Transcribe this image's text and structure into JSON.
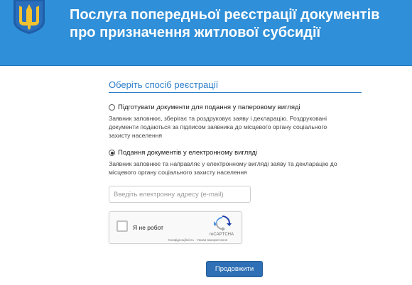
{
  "header": {
    "title_line1": "Послуга попередньої реєстрації документів",
    "title_line2": "про призначення житлової субсидії",
    "emblem_icon": "trident-emblem-icon",
    "background_color": "#2f8fd8"
  },
  "registration": {
    "section_title": "Оберіть спосіб реєстрації",
    "options": [
      {
        "label": "Підготувати документи для подання у паперовому вигляді",
        "description_line1": "Заявник заповнює, зберігає та роздруковує заяву і декларацію. Роздруковані",
        "description_line2": "документи подаються за підписом заявника до місцевого органу соціального",
        "description_line3": "захисту населення",
        "selected": false
      },
      {
        "label": "Подання документів у електронному вигляді",
        "description_line1": "Заявник заповнює та направляє у електронному вигляді заяву та декларацію до",
        "description_line2": "місцевого органу соціального захисту населення",
        "selected": true
      }
    ],
    "email": {
      "placeholder": "Введіть електронну адресу (e-mail)",
      "value": ""
    },
    "captcha": {
      "label": "Я не робот",
      "brand": "reCAPTCHA",
      "terms": "Конфіденційність - Умови використання",
      "logo_icon": "recaptcha-logo-icon"
    },
    "submit_label": "Продовжити",
    "accent_color": "#2c7ec8"
  }
}
